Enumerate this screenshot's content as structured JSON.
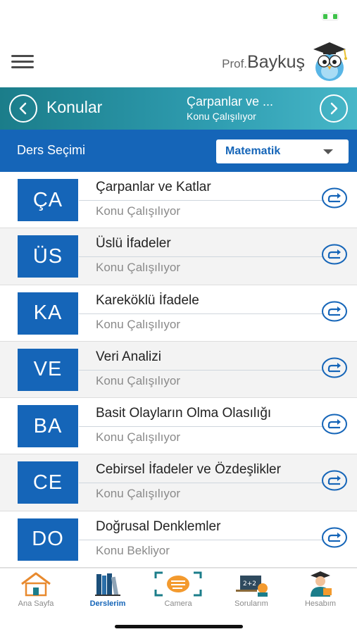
{
  "header": {
    "brand_prefix": "Prof.",
    "brand_name": "Baykuş"
  },
  "nav": {
    "back_label": "Konular",
    "current_title": "Çarpanlar ve ...",
    "current_status": "Konu Çalışılıyor"
  },
  "ders": {
    "label": "Ders Seçimi",
    "selected": "Matematik"
  },
  "topics": [
    {
      "abbr": "ÇA",
      "title": "Çarpanlar ve Katlar",
      "status": "Konu Çalışılıyor"
    },
    {
      "abbr": "ÜS",
      "title": "Üslü İfadeler",
      "status": "Konu Çalışılıyor"
    },
    {
      "abbr": "KA",
      "title": "Kareköklü İfadele",
      "status": "Konu Çalışılıyor"
    },
    {
      "abbr": "VE",
      "title": "Veri Analizi",
      "status": "Konu Çalışılıyor"
    },
    {
      "abbr": "BA",
      "title": "Basit Olayların Olma Olasılığı",
      "status": "Konu Çalışılıyor"
    },
    {
      "abbr": "CE",
      "title": "Cebirsel İfadeler ve Özdeşlikler",
      "status": "Konu Çalışılıyor"
    },
    {
      "abbr": "DO",
      "title": "Doğrusal Denklemler",
      "status": "Konu Bekliyor"
    }
  ],
  "tabs": [
    {
      "label": "Ana Sayfa",
      "icon": "home-icon"
    },
    {
      "label": "Derslerim",
      "icon": "books-icon"
    },
    {
      "label": "Camera",
      "icon": "camera-icon"
    },
    {
      "label": "Sorularım",
      "icon": "questions-icon"
    },
    {
      "label": "Hesabım",
      "icon": "account-icon"
    }
  ],
  "colors": {
    "primary_blue": "#1565b8",
    "teal_start": "#1b7d8a",
    "teal_end": "#47b7c8",
    "battery_green": "#3ec24a"
  }
}
